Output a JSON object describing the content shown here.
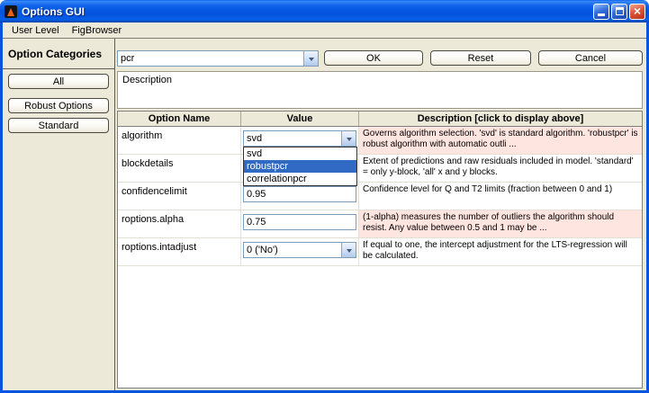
{
  "window": {
    "title": "Options GUI",
    "controls": {
      "close_glyph": "×"
    }
  },
  "menubar": {
    "items": [
      {
        "label": "User Level"
      },
      {
        "label": "FigBrowser"
      }
    ]
  },
  "sidebar": {
    "header": "Option Categories",
    "buttons": [
      {
        "label": "All"
      },
      {
        "label": "Robust Options"
      },
      {
        "label": "Standard"
      }
    ]
  },
  "toolbar": {
    "option_set": "pcr",
    "ok": "OK",
    "reset": "Reset",
    "cancel": "Cancel"
  },
  "description_panel": {
    "label": "Description",
    "content": ""
  },
  "options_table": {
    "headers": {
      "name": "Option Name",
      "value": "Value",
      "description": "Description [click to display above]"
    },
    "rows": [
      {
        "name": "algorithm",
        "value": "svd",
        "control": "combo",
        "description": "Governs algorithm selection. 'svd' is standard algorithm. 'robustpcr' is robust algorithm with automatic outli ...",
        "highlighted": true
      },
      {
        "name": "blockdetails",
        "value": "",
        "control": "combo",
        "description": "Extent of predictions and raw residuals included in model. 'standard' = only y-block, 'all' x and y blocks.",
        "highlighted": false
      },
      {
        "name": "confidencelimit",
        "value": "0.95",
        "control": "text",
        "description": "Confidence level for Q and T2 limits (fraction between 0 and 1)",
        "highlighted": false
      },
      {
        "name": "roptions.alpha",
        "value": "0.75",
        "control": "text",
        "description": "(1-alpha) measures the number of outliers the algorithm should resist. Any value between 0.5 and 1 may be ...",
        "highlighted": true
      },
      {
        "name": "roptions.intadjust",
        "value": "0 ('No')",
        "control": "combo",
        "description": "If equal to one, the intercept adjustment for the LTS-regression will be calculated.",
        "highlighted": false
      }
    ]
  },
  "algorithm_dropdown": {
    "options": [
      {
        "label": "svd"
      },
      {
        "label": "robustpcr"
      },
      {
        "label": "correlationpcr"
      }
    ],
    "selected": "robustpcr"
  },
  "colors": {
    "titlebar_blue": "#0855dd",
    "selection_blue": "#316ac5",
    "highlight_pink": "#ffe5e0",
    "window_beige": "#ece9d8"
  }
}
